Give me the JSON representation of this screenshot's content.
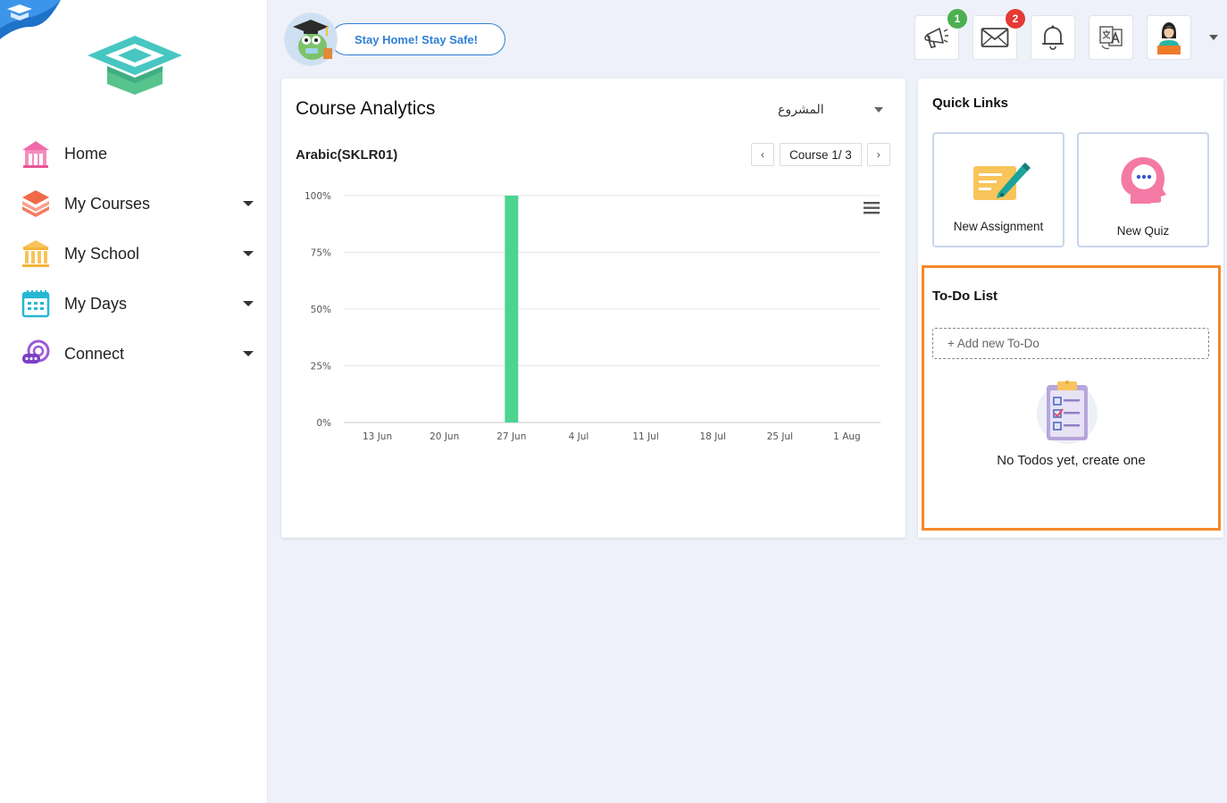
{
  "sidebar": {
    "items": [
      {
        "label": "Home",
        "icon": "home-icon",
        "has_submenu": false
      },
      {
        "label": "My Courses",
        "icon": "courses-icon",
        "has_submenu": true
      },
      {
        "label": "My School",
        "icon": "school-icon",
        "has_submenu": true
      },
      {
        "label": "My Days",
        "icon": "calendar-icon",
        "has_submenu": true
      },
      {
        "label": "Connect",
        "icon": "chat-icon",
        "has_submenu": true
      }
    ]
  },
  "header": {
    "banner_text": "Stay Home! Stay Safe!",
    "icons": [
      {
        "name": "announcements-icon",
        "badge": "1",
        "badge_color": "#4caf50"
      },
      {
        "name": "mail-icon",
        "badge": "2",
        "badge_color": "#e53935"
      },
      {
        "name": "bell-icon",
        "badge": ""
      },
      {
        "name": "translate-icon",
        "badge": ""
      },
      {
        "name": "profile-avatar",
        "badge": ""
      }
    ]
  },
  "analytics": {
    "title": "Course Analytics",
    "select_value": "المشروع",
    "course_name": "Arabic(SKLR01)",
    "pager_label": "Course 1/ 3",
    "prev_label": "‹",
    "next_label": "›"
  },
  "chart_data": {
    "type": "bar",
    "categories": [
      "13 Jun",
      "20 Jun",
      "27 Jun",
      "4 Jul",
      "11 Jul",
      "18 Jul",
      "25 Jul",
      "1 Aug"
    ],
    "values": [
      0,
      0,
      100,
      0,
      0,
      0,
      0,
      0
    ],
    "y_ticks": [
      "0%",
      "25%",
      "50%",
      "75%",
      "100%"
    ],
    "ylim": [
      0,
      100
    ],
    "bar_color": "#4cd490",
    "grid": true,
    "title": "",
    "xlabel": "",
    "ylabel": ""
  },
  "quick_links": {
    "title": "Quick Links",
    "items": [
      {
        "label": "New Assignment",
        "icon": "assignment-icon"
      },
      {
        "label": "New Quiz",
        "icon": "quiz-icon"
      }
    ]
  },
  "todo": {
    "title": "To-Do List",
    "add_placeholder": "+ Add new To-Do",
    "empty_text": "No Todos yet, create one"
  },
  "colors": {
    "accent": "#2f7fd6",
    "highlight": "#f5892b",
    "chart_bar": "#4cd490"
  }
}
